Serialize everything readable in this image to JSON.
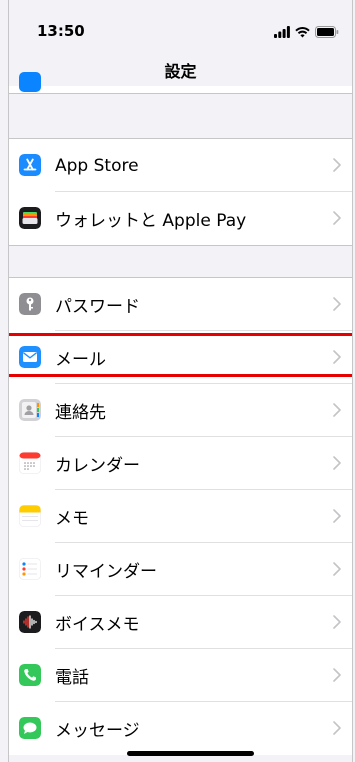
{
  "status": {
    "time": "13:50",
    "icons": [
      "signal-icon",
      "wifi-icon",
      "battery-icon"
    ]
  },
  "nav": {
    "title": "設定"
  },
  "groups": [
    {
      "items": [
        {
          "label": "App Store",
          "icon": "app-store-icon",
          "color": "#0a84ff"
        },
        {
          "label": "ウォレットと Apple Pay",
          "icon": "wallet-icon",
          "color": "#000000"
        }
      ]
    },
    {
      "items": [
        {
          "label": "パスワード",
          "icon": "key-icon",
          "color": "#8e8e93"
        },
        {
          "label": "メール",
          "icon": "mail-icon",
          "color": "#1e90ff",
          "highlighted": true
        },
        {
          "label": "連絡先",
          "icon": "contacts-icon",
          "color": "#c7c7cc"
        },
        {
          "label": "カレンダー",
          "icon": "calendar-icon",
          "color": "#ff3b30"
        },
        {
          "label": "メモ",
          "icon": "notes-icon",
          "color": "#ffcc00"
        },
        {
          "label": "リマインダー",
          "icon": "reminders-icon",
          "color": "#ffffff"
        },
        {
          "label": "ボイスメモ",
          "icon": "voice-memos-icon",
          "color": "#1c1c1e"
        },
        {
          "label": "電話",
          "icon": "phone-icon",
          "color": "#34c759"
        },
        {
          "label": "メッセージ",
          "icon": "messages-icon",
          "color": "#34c759"
        }
      ]
    }
  ],
  "highlight_color": "#e60000"
}
